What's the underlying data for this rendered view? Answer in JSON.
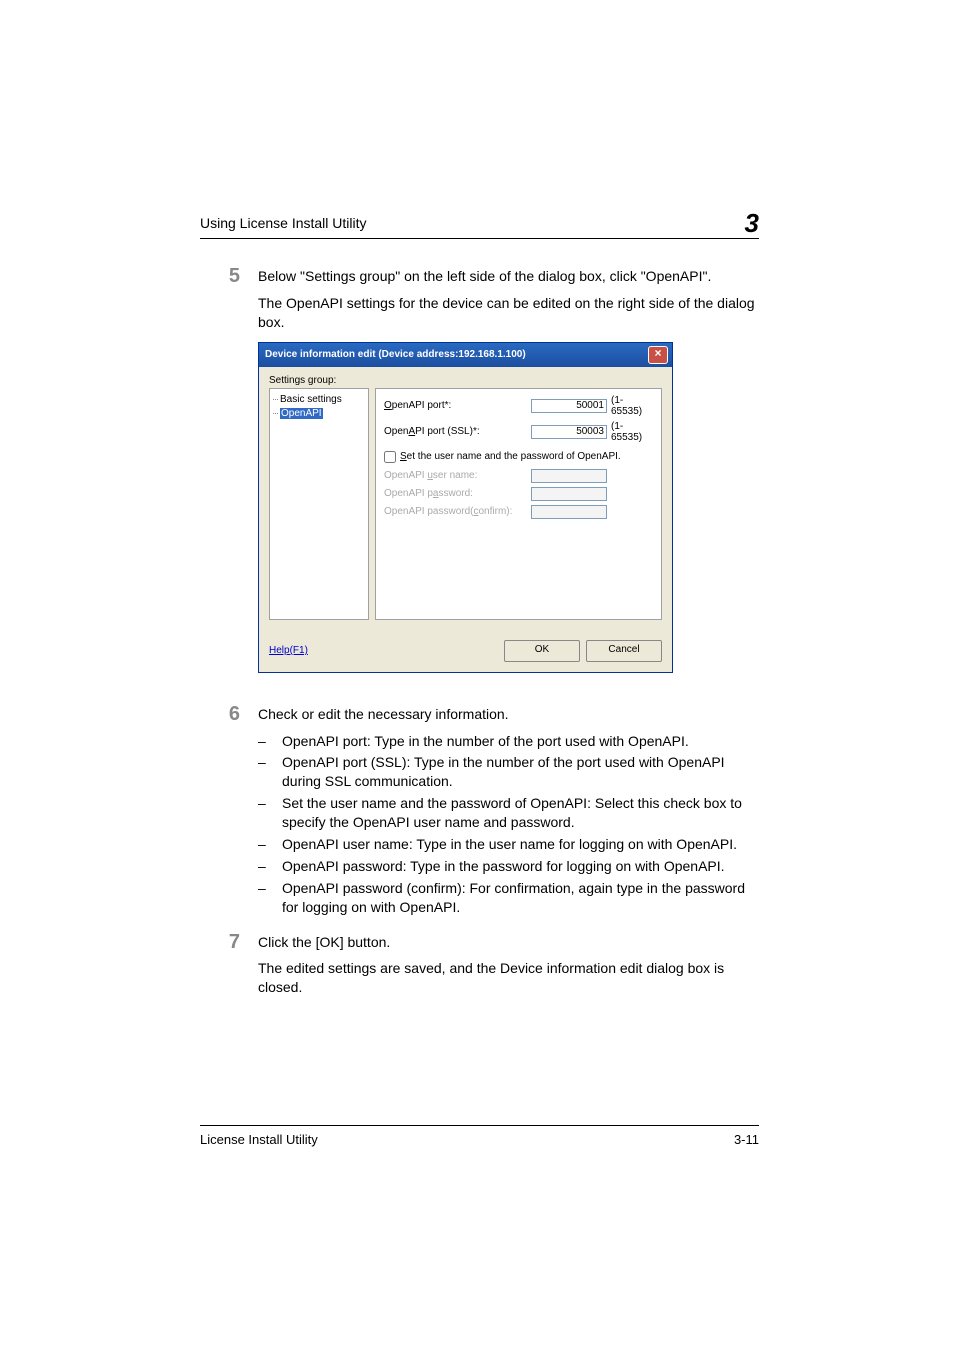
{
  "header": {
    "title": "Using License Install Utility",
    "chapter": "3"
  },
  "step5": {
    "num": "5",
    "p1": "Below \"Settings group\" on the left side of the dialog box, click \"OpenAPI\".",
    "p2": "The OpenAPI settings for the device can be edited on the right side of the dialog box."
  },
  "dialog": {
    "title": "Device information edit (Device address:192.168.1.100)",
    "close": "×",
    "settings_group": "Settings group:",
    "tree_basic": "Basic settings",
    "tree_openapi": "OpenAPI",
    "openapi_port_label": "OpenAPI port*:",
    "openapi_port_value": "50001",
    "openapi_port_range": "(1-65535)",
    "openapi_ssl_label": "OpenAPI port (SSL)*:",
    "openapi_ssl_value": "50003",
    "openapi_ssl_range": "(1-65535)",
    "set_checkbox": "Set the user name and the password of OpenAPI.",
    "user_name_label": "OpenAPI user name:",
    "password_label": "OpenAPI password:",
    "password_confirm_label": "OpenAPI password(confirm):",
    "help": "Help(F1)",
    "ok": "OK",
    "cancel": "Cancel"
  },
  "step6": {
    "num": "6",
    "p1": "Check or edit the necessary information.",
    "b1": "OpenAPI port: Type in the number of the port used with OpenAPI.",
    "b2": "OpenAPI port (SSL): Type in the number of the port used with OpenAPI during SSL communication.",
    "b3": "Set the user name and the password of OpenAPI: Select this check box to specify the OpenAPI user name and password.",
    "b4": "OpenAPI user name: Type in the user name for logging on with OpenAPI.",
    "b5": "OpenAPI password: Type in the password for logging on with OpenAPI.",
    "b6": "OpenAPI password (confirm): For confirmation, again type in the password for logging on with OpenAPI."
  },
  "step7": {
    "num": "7",
    "p1": "Click the [OK] button.",
    "p2": "The edited settings are saved, and the Device information edit dialog box is closed."
  },
  "footer": {
    "left": "License Install Utility",
    "right": "3-11"
  }
}
